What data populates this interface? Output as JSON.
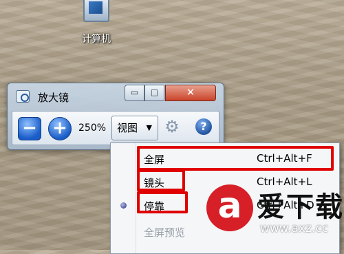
{
  "desktop": {
    "icon_label": "计算机"
  },
  "window": {
    "title": "放大镜",
    "minimize_glyph": "▭",
    "maximize_glyph": "□",
    "close_glyph": "✕"
  },
  "toolbar": {
    "zoom_out_glyph": "−",
    "zoom_in_glyph": "+",
    "zoom_level": "250%",
    "view_label": "视图",
    "dropdown_glyph": "▼",
    "settings_glyph": "⚙",
    "help_glyph": "?"
  },
  "menu": {
    "items": [
      {
        "label": "全屏",
        "shortcut": "Ctrl+Alt+F"
      },
      {
        "label": "镜头",
        "shortcut": "Ctrl+Alt+L"
      },
      {
        "label": "停靠",
        "shortcut": "Ctrl+Alt+D"
      },
      {
        "label": "全屏预览",
        "shortcut": ""
      }
    ]
  },
  "watermark": {
    "logo_char": "a",
    "name": "爱下载",
    "url": "www.axz.cc"
  },
  "colors": {
    "highlight": "#e00000",
    "accent": "#1a5dc8"
  }
}
